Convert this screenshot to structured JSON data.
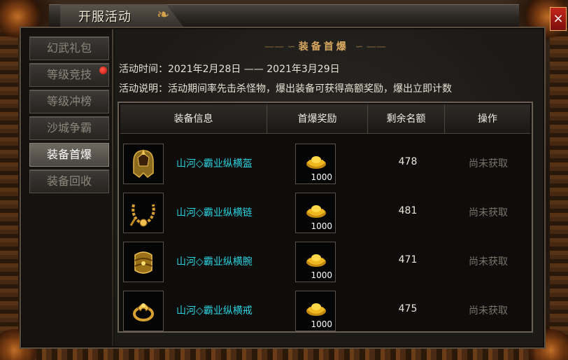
{
  "window": {
    "title": "开服活动",
    "close_label": "×"
  },
  "nav": {
    "items": [
      {
        "label": "幻武礼包",
        "active": false,
        "badge": false
      },
      {
        "label": "等级竞技",
        "active": false,
        "badge": true
      },
      {
        "label": "等级冲榜",
        "active": false,
        "badge": false
      },
      {
        "label": "沙城争霸",
        "active": false,
        "badge": false
      },
      {
        "label": "装备首爆",
        "active": true,
        "badge": false
      },
      {
        "label": "装备回收",
        "active": false,
        "badge": false
      }
    ]
  },
  "section": {
    "title": "装备首爆",
    "time_label": "活动时间：",
    "time_value": "2021年2月28日 —— 2021年3月29日",
    "desc_label": "活动说明：",
    "desc_value": "活动期间率先击杀怪物，爆出装备可获得高额奖励，爆出立即计数"
  },
  "table": {
    "headers": [
      "装备信息",
      "首爆奖励",
      "剩余名额",
      "操作"
    ],
    "rows": [
      {
        "icon": "helmet-icon",
        "name": "山河◇霸业纵横盔",
        "reward_icon": "gold-ingot-icon",
        "reward_qty": "1000",
        "remaining": "478",
        "status": "尚未获取"
      },
      {
        "icon": "necklace-icon",
        "name": "山河◇霸业纵横链",
        "reward_icon": "gold-ingot-icon",
        "reward_qty": "1000",
        "remaining": "481",
        "status": "尚未获取"
      },
      {
        "icon": "bracelet-icon",
        "name": "山河◇霸业纵横腕",
        "reward_icon": "gold-ingot-icon",
        "reward_qty": "1000",
        "remaining": "471",
        "status": "尚未获取"
      },
      {
        "icon": "ring-icon",
        "name": "山河◇霸业纵横戒",
        "reward_icon": "gold-ingot-icon",
        "reward_qty": "1000",
        "remaining": "475",
        "status": "尚未获取"
      }
    ]
  },
  "colors": {
    "item_name": "#2ad2e0",
    "title_gold": "#d8a860",
    "badge_red": "#e0180e",
    "close_red": "#c4261c"
  }
}
